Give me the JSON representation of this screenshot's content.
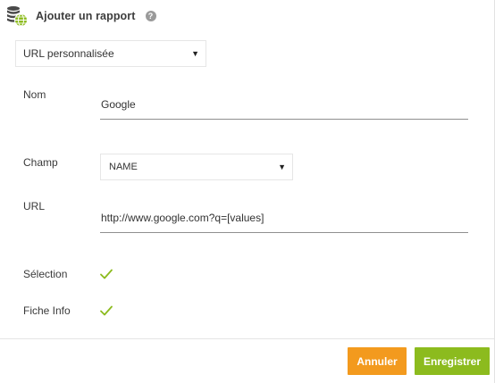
{
  "header": {
    "title": "Ajouter un rapport",
    "help_glyph": "?",
    "app_icon": "database-globe-icon",
    "help_icon": "question-circle-icon"
  },
  "report_type": {
    "selected": "URL personnalisée"
  },
  "form": {
    "nom_label": "Nom",
    "nom_value": "Google",
    "champ_label": "Champ",
    "champ_selected": "NAME",
    "url_label": "URL",
    "url_value": "http://www.google.com?q=[values]",
    "selection_label": "Sélection",
    "selection_checked": true,
    "fiche_info_label": "Fiche Info",
    "fiche_info_checked": true,
    "check_icon": "checkmark-icon",
    "dropdown_glyph": "▼"
  },
  "footer": {
    "cancel_label": "Annuler",
    "save_label": "Enregistrer"
  },
  "colors": {
    "cancel_button": "#f39a1e",
    "save_button": "#8cbb1e",
    "checkmark": "#8cbb1e",
    "globe": "#8cbb1e"
  }
}
